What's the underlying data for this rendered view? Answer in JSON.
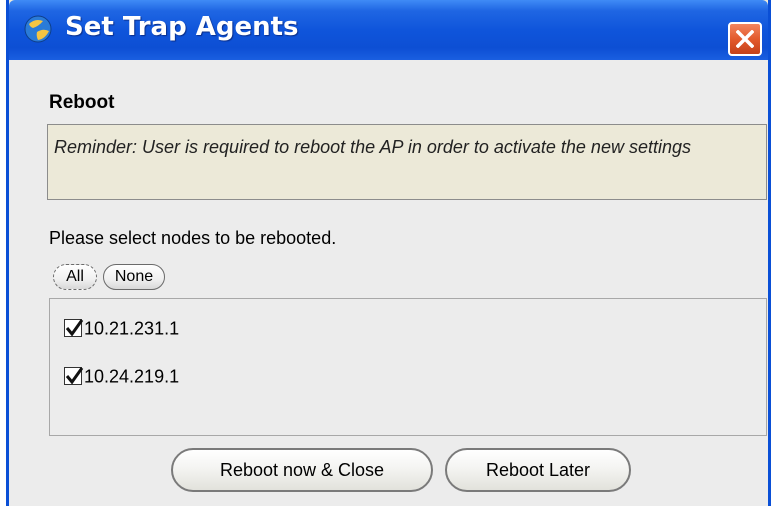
{
  "window": {
    "title": "Set Trap Agents"
  },
  "section": {
    "title": "Reboot"
  },
  "reminder": {
    "text": "Reminder: User is required to reboot the AP in order to activate the new settings"
  },
  "prompt": {
    "text": "Please select nodes to be rebooted."
  },
  "selection_buttons": {
    "all_label": "All",
    "none_label": "None"
  },
  "nodes": [
    {
      "label": "10.21.231.1",
      "checked": true
    },
    {
      "label": "10.24.219.1",
      "checked": true
    }
  ],
  "actions": {
    "reboot_now_label": "Reboot now & Close",
    "reboot_later_label": "Reboot Later"
  },
  "colors": {
    "titlebar": "#0d4fd4",
    "close_button": "#e35a2c",
    "panel_background": "#ececec",
    "reminder_background": "#ece9d8"
  }
}
